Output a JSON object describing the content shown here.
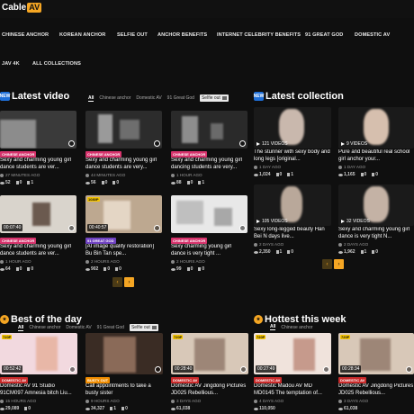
{
  "header": {
    "logo_main": "Cable",
    "logo_badge": "AV"
  },
  "nav": [
    "CHINESE ANCHOR",
    "KOREAN ANCHOR",
    "SELFIE OUT",
    "ANCHOR BENEFITS",
    "INTERNET CELEBRITY BENEFITS",
    "91 GREAT GOD",
    "DOMESTIC AV",
    "JAV 4K",
    "ALL COLLECTIONS"
  ],
  "latest_video": {
    "badge": "NEW",
    "title": "Latest video",
    "filters": [
      "All",
      "Chinese anchor",
      "Domestic AV",
      "91 Great God",
      "Selfie out"
    ],
    "cards": [
      {
        "duration": "",
        "tag": "CHINESE ANCHOR",
        "title": "Sexy and charming young girl dance students are ver...",
        "time": "27 MINUTES AGO",
        "views": "52",
        "likes": "0",
        "comments": "1"
      },
      {
        "duration": "",
        "tag": "CHINESE ANCHOR",
        "title": "Sexy and charming young girl dance students are very...",
        "time": "44 MINUTES AGO",
        "views": "56",
        "likes": "0",
        "comments": "0"
      },
      {
        "duration": "",
        "tag": "CHINESE ANCHOR",
        "title": "Sexy and charming young girl dancing students are very...",
        "time": "1 HOUR AGO",
        "views": "88",
        "likes": "0",
        "comments": "1"
      },
      {
        "duration": "00:07:40",
        "tag": "CHINESE ANCHOR",
        "title": "Sexy and charming young girl dance students are ver...",
        "time": "1 HOUR AGO",
        "views": "64",
        "likes": "0",
        "comments": "0"
      },
      {
        "duration": "00:40:57",
        "quality": "1080P",
        "tag": "91 GREAT GOD",
        "title": "[AI image quality restoration] Bu Bin Tan spe...",
        "time": "2 HOURS AGO",
        "views": "902",
        "likes": "0",
        "comments": "0"
      },
      {
        "duration": "",
        "tag": "CHINESE ANCHOR",
        "title": "Sexy charming young girl dance is very tight ...",
        "time": "2 HOURS AGO",
        "views": "99",
        "likes": "0",
        "comments": "0"
      }
    ]
  },
  "latest_collection": {
    "badge": "NEW",
    "title": "Latest collection",
    "cards": [
      {
        "videos": "121 VIDEOS",
        "title": "The stunner with sexy body and long legs [original...",
        "time": "1 DAY AGO",
        "views": "1,024",
        "likes": "0",
        "comments": "1"
      },
      {
        "videos": "9 VIDEOS",
        "title": "Pure and beautiful real school girl anchor your...",
        "time": "1 DAY AGO",
        "views": "1,165",
        "likes": "0",
        "comments": "0"
      },
      {
        "videos": "105 VIDEOS",
        "title": "Sexy long-legged beauty Han Bei N days live...",
        "time": "2 DAYS AGO",
        "views": "2,350",
        "likes": "1",
        "comments": "0"
      },
      {
        "videos": "32 VIDEOS",
        "title": "Sexy and charming young girl dance is very tight N...",
        "time": "2 DAYS AGO",
        "views": "1,962",
        "likes": "1",
        "comments": "0"
      }
    ]
  },
  "best_of_day": {
    "title": "Best of the day",
    "filters": [
      "All",
      "Chinese anchor",
      "Domestic AV",
      "91 Great God",
      "Selfie out"
    ],
    "cards": [
      {
        "quality": "720P",
        "duration": "00:52:42",
        "tag": "DOMESTIC AV",
        "title": "Domestic AV 91 Studio 91CM097 Amnesia bitch Liu...",
        "time": "15 HOURS AGO",
        "views": "29,089",
        "likes": "0",
        "comments": ""
      },
      {
        "quality": "",
        "duration": "",
        "tag": "BUSTY OUT",
        "title": "Call appointments to take a busty sister",
        "time": "9 HOURS AGO",
        "views": "34,327",
        "likes": "1",
        "comments": "0"
      },
      {
        "quality": "720P",
        "duration": "00:28:40",
        "tag": "DOMESTIC AV",
        "title": "Domestic AV Jingdong Pictures JD025 Rebellious...",
        "time": "3 DAYS AGO",
        "views": "61,038",
        "likes": "",
        "comments": ""
      }
    ]
  },
  "hottest_week": {
    "title": "Hottest this week",
    "filters": [
      "All",
      "Chinese anchor"
    ],
    "cards": [
      {
        "quality": "720P",
        "duration": "00:27:49",
        "tag": "DOMESTIC AV",
        "title": "Domestic Madou AV MD MD0145 The temptation of...",
        "time": "4 DAYS AGO",
        "views": "110,050",
        "likes": "",
        "comments": ""
      },
      {
        "quality": "720P",
        "duration": "00:28:34",
        "tag": "DOMESTIC AV",
        "title": "Domestic AV Jingdong Pictures JD025 Rebellious...",
        "time": "3 DAYS AGO",
        "views": "61,038",
        "likes": "",
        "comments": ""
      }
    ]
  },
  "colors": {
    "accent": "#f5a623",
    "background": "#0f0f0f",
    "tag_pink": "#d6336c",
    "tag_purple": "#6f42c1"
  }
}
